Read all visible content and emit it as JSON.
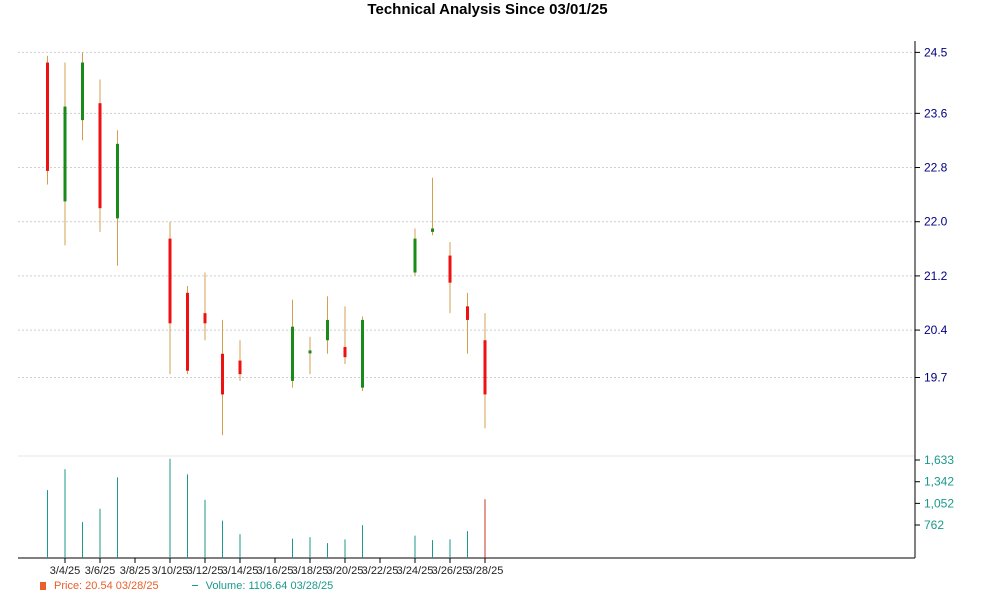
{
  "chart_data": {
    "type": "candlestick",
    "title": "Technical Analysis Since 03/01/25",
    "price_axis": {
      "ticks": [
        "24.5",
        "23.6",
        "22.8",
        "22.0",
        "21.2",
        "20.4",
        "19.7"
      ],
      "range": [
        18.6,
        24.55
      ]
    },
    "volume_axis": {
      "ticks": [
        "1,633",
        "1,342",
        "1,052",
        "762"
      ],
      "range": [
        320,
        1633
      ]
    },
    "x_axis": {
      "ticks": [
        "3/4/25",
        "3/6/25",
        "3/8/25",
        "3/10/25",
        "3/12/25",
        "3/14/25",
        "3/16/25",
        "3/18/25",
        "3/20/25",
        "3/22/25",
        "3/24/25",
        "3/26/25",
        "3/28/25"
      ]
    },
    "grid": true,
    "colors": {
      "up": "#1a8a1a",
      "down": "#ee1111",
      "wick": "#d4a050",
      "volume": "#1a9a8a",
      "volume_last": "#cc3322",
      "price_axis_text": "#000080",
      "volume_axis_text": "#1a9a8a"
    },
    "candles": [
      {
        "date": "3/3/25",
        "open": 24.35,
        "high": 24.45,
        "low": 22.55,
        "close": 22.75,
        "volume": 1230
      },
      {
        "date": "3/4/25",
        "open": 22.3,
        "high": 24.35,
        "low": 21.65,
        "close": 23.7,
        "volume": 1510
      },
      {
        "date": "3/5/25",
        "open": 23.5,
        "high": 24.5,
        "low": 23.2,
        "close": 24.35,
        "volume": 800
      },
      {
        "date": "3/6/25",
        "open": 23.75,
        "high": 24.1,
        "low": 21.85,
        "close": 22.2,
        "volume": 980
      },
      {
        "date": "3/7/25",
        "open": 22.05,
        "high": 23.35,
        "low": 21.35,
        "close": 23.15,
        "volume": 1400
      },
      {
        "date": "3/10/25",
        "open": 21.75,
        "high": 22.0,
        "low": 19.75,
        "close": 20.5,
        "volume": 1650
      },
      {
        "date": "3/11/25",
        "open": 20.95,
        "high": 21.05,
        "low": 19.75,
        "close": 19.8,
        "volume": 1440
      },
      {
        "date": "3/12/25",
        "open": 20.65,
        "high": 21.25,
        "low": 20.25,
        "close": 20.5,
        "volume": 1100
      },
      {
        "date": "3/13/25",
        "open": 20.05,
        "high": 20.55,
        "low": 18.85,
        "close": 19.45,
        "volume": 820
      },
      {
        "date": "3/14/25",
        "open": 19.95,
        "high": 20.25,
        "low": 19.65,
        "close": 19.75,
        "volume": 640
      },
      {
        "date": "3/17/25",
        "open": 19.65,
        "high": 20.85,
        "low": 19.55,
        "close": 20.45,
        "volume": 580
      },
      {
        "date": "3/18/25",
        "open": 20.1,
        "high": 20.3,
        "low": 19.75,
        "close": 20.1,
        "volume": 600
      },
      {
        "date": "3/19/25",
        "open": 20.25,
        "high": 20.9,
        "low": 20.05,
        "close": 20.55,
        "volume": 520
      },
      {
        "date": "3/20/25",
        "open": 20.15,
        "high": 20.75,
        "low": 19.9,
        "close": 20.0,
        "volume": 570
      },
      {
        "date": "3/21/25",
        "open": 19.55,
        "high": 20.6,
        "low": 19.5,
        "close": 20.55,
        "volume": 760
      },
      {
        "date": "3/24/25",
        "open": 21.25,
        "high": 21.9,
        "low": 21.2,
        "close": 21.75,
        "volume": 620
      },
      {
        "date": "3/25/25",
        "open": 21.85,
        "high": 22.65,
        "low": 21.8,
        "close": 21.9,
        "volume": 560
      },
      {
        "date": "3/26/25",
        "open": 21.5,
        "high": 21.7,
        "low": 20.65,
        "close": 21.1,
        "volume": 570
      },
      {
        "date": "3/27/25",
        "open": 20.75,
        "high": 20.95,
        "low": 20.05,
        "close": 20.55,
        "volume": 680
      },
      {
        "date": "3/28/25",
        "open": 20.25,
        "high": 20.65,
        "low": 18.95,
        "close": 19.45,
        "volume": 1107
      }
    ]
  },
  "legend": {
    "price_label": "Price: 20.54  03/28/25",
    "volume_label": "Volume: 1106.64  03/28/25"
  }
}
